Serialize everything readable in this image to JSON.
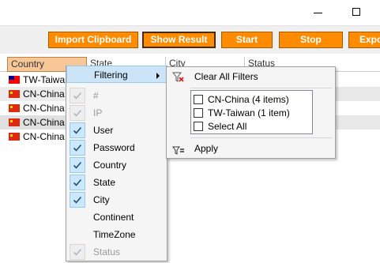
{
  "toolbar": {
    "buttons": [
      {
        "label": "Import Clipboard"
      },
      {
        "label": "Show Result"
      },
      {
        "label": "Start"
      },
      {
        "label": "Stop"
      },
      {
        "label": "Expo"
      }
    ]
  },
  "grid": {
    "columns": [
      "Country",
      "State",
      "City",
      "Status"
    ],
    "rows": [
      {
        "country": "TW-Taiwan",
        "flag": "tw"
      },
      {
        "country": "CN-China",
        "flag": "cn"
      },
      {
        "country": "CN-China",
        "flag": "cn"
      },
      {
        "country": "CN-China",
        "flag": "cn"
      },
      {
        "country": "CN-China",
        "flag": "cn"
      }
    ]
  },
  "context_menu": {
    "items": [
      {
        "label": "Filtering",
        "checked": false,
        "disabled": false,
        "submenu": true
      },
      {
        "label": "#",
        "checked": true,
        "disabled": true
      },
      {
        "label": "IP",
        "checked": true,
        "disabled": true
      },
      {
        "label": "User",
        "checked": true,
        "disabled": false
      },
      {
        "label": "Password",
        "checked": true,
        "disabled": false
      },
      {
        "label": "Country",
        "checked": true,
        "disabled": false
      },
      {
        "label": "State",
        "checked": true,
        "disabled": false
      },
      {
        "label": "City",
        "checked": true,
        "disabled": false
      },
      {
        "label": "Continent",
        "checked": false,
        "disabled": false
      },
      {
        "label": "TimeZone",
        "checked": false,
        "disabled": false
      },
      {
        "label": "Status",
        "checked": true,
        "disabled": true
      }
    ]
  },
  "filter_menu": {
    "clear_label": "Clear All Filters",
    "options": [
      {
        "label": "CN-China (4 items)",
        "checked": false
      },
      {
        "label": "TW-Taiwan (1 item)",
        "checked": false
      },
      {
        "label": "Select All",
        "checked": false
      }
    ],
    "apply_label": "Apply"
  },
  "colors": {
    "button_orange": "#ff8c00",
    "selected_header": "#f7c797",
    "menu_highlight": "#cce4f7"
  }
}
